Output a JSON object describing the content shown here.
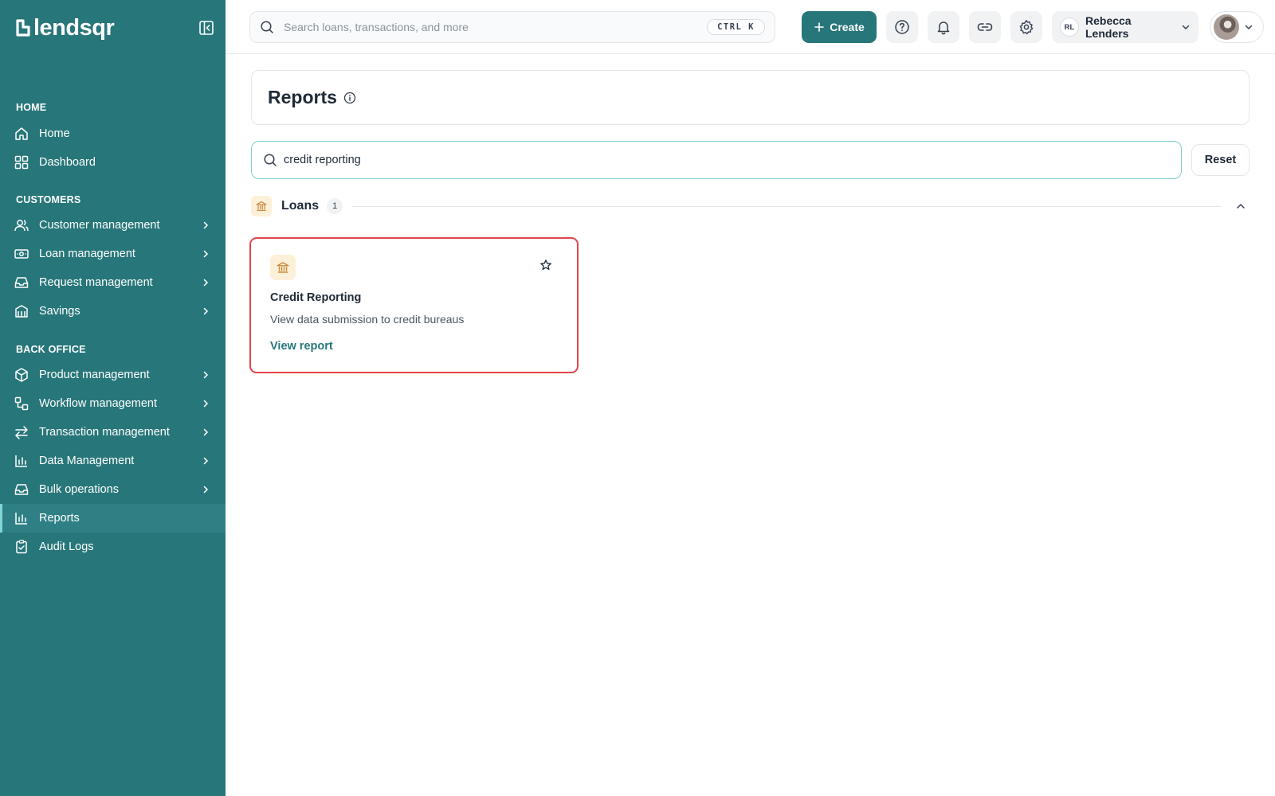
{
  "sidebar": {
    "logo_text": "lendsqr",
    "sections": [
      {
        "title": "HOME",
        "items": [
          {
            "label": "Home",
            "icon": "home-icon"
          },
          {
            "label": "Dashboard",
            "icon": "dashboard-icon"
          }
        ]
      },
      {
        "title": "CUSTOMERS",
        "items": [
          {
            "label": "Customer management",
            "icon": "users-icon"
          },
          {
            "label": "Loan management",
            "icon": "cash-icon"
          },
          {
            "label": "Request management",
            "icon": "inbox-icon"
          },
          {
            "label": "Savings",
            "icon": "piggy-bank-icon"
          }
        ]
      },
      {
        "title": "BACK OFFICE",
        "items": [
          {
            "label": "Product management",
            "icon": "box-icon"
          },
          {
            "label": "Workflow management",
            "icon": "workflow-icon"
          },
          {
            "label": "Transaction management",
            "icon": "transfer-icon"
          },
          {
            "label": "Data Management",
            "icon": "bar-chart-icon"
          },
          {
            "label": "Bulk operations",
            "icon": "inbox-icon"
          },
          {
            "label": "Reports",
            "icon": "bar-chart-icon",
            "active": true
          },
          {
            "label": "Audit Logs",
            "icon": "clipboard-check-icon"
          }
        ]
      }
    ]
  },
  "topbar": {
    "search_placeholder": "Search loans, transactions, and more",
    "shortcut": "CTRL K",
    "create_label": "Create",
    "user_initials": "RL",
    "user_name": "Rebecca Lenders"
  },
  "page": {
    "title": "Reports",
    "filter_value": "credit reporting",
    "reset_label": "Reset",
    "group": {
      "label": "Loans",
      "count": "1"
    },
    "card": {
      "title": "Credit Reporting",
      "description": "View data submission to credit bureaus",
      "link_label": "View report"
    }
  },
  "colors": {
    "sidebar_bg": "#27767a",
    "accent": "#27767a",
    "highlight_border": "#e1454c",
    "badge_bg": "#fdf0d8",
    "badge_icon": "#c8873a"
  }
}
